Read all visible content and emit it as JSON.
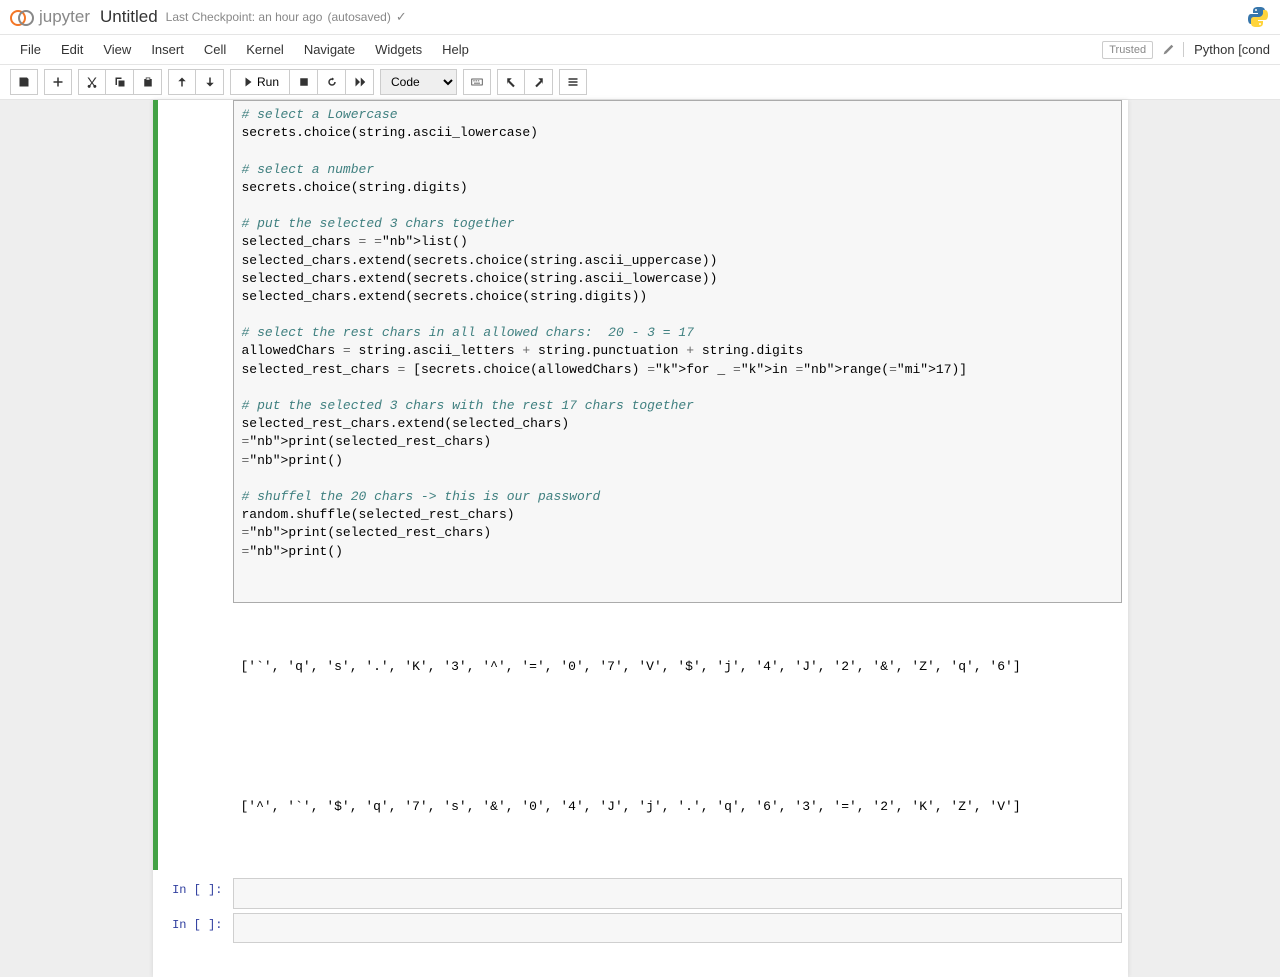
{
  "header": {
    "logo_text": "jupyter",
    "title": "Untitled",
    "checkpoint": "Last Checkpoint: an hour ago",
    "autosave": "(autosaved)"
  },
  "menubar": {
    "items": [
      "File",
      "Edit",
      "View",
      "Insert",
      "Cell",
      "Kernel",
      "Navigate",
      "Widgets",
      "Help"
    ],
    "trusted": "Trusted",
    "kernel": "Python [cond"
  },
  "toolbar": {
    "run_label": "Run",
    "cell_type": "Code"
  },
  "code": {
    "lines": [
      {
        "t": "comment",
        "text": "# select a Lowercase"
      },
      {
        "t": "plain",
        "text": "secrets.choice(string.ascii_lowercase)"
      },
      {
        "t": "blank",
        "text": ""
      },
      {
        "t": "comment",
        "text": "# select a number"
      },
      {
        "t": "plain",
        "text": "secrets.choice(string.digits)"
      },
      {
        "t": "blank",
        "text": ""
      },
      {
        "t": "comment",
        "text": "# put the selected 3 chars together"
      },
      {
        "t": "mixed",
        "text": "selected_chars = list()"
      },
      {
        "t": "plain",
        "text": "selected_chars.extend(secrets.choice(string.ascii_uppercase))"
      },
      {
        "t": "plain",
        "text": "selected_chars.extend(secrets.choice(string.ascii_lowercase))"
      },
      {
        "t": "plain",
        "text": "selected_chars.extend(secrets.choice(string.digits))"
      },
      {
        "t": "blank",
        "text": ""
      },
      {
        "t": "comment",
        "text": "# select the rest chars in all allowed chars:  20 - 3 = 17"
      },
      {
        "t": "mixed2",
        "text": "allowedChars = string.ascii_letters + string.punctuation + string.digits"
      },
      {
        "t": "mixed3",
        "text": "selected_rest_chars = [secrets.choice(allowedChars) for _ in range(17)]"
      },
      {
        "t": "blank",
        "text": ""
      },
      {
        "t": "comment",
        "text": "# put the selected 3 chars with the rest 17 chars together"
      },
      {
        "t": "plain",
        "text": "selected_rest_chars.extend(selected_chars)"
      },
      {
        "t": "print",
        "text": "print(selected_rest_chars)"
      },
      {
        "t": "print2",
        "text": "print()"
      },
      {
        "t": "blank",
        "text": ""
      },
      {
        "t": "comment",
        "text": "# shuffel the 20 chars -> this is our password"
      },
      {
        "t": "plain",
        "text": "random.shuffle(selected_rest_chars)"
      },
      {
        "t": "print",
        "text": "print(selected_rest_chars)"
      },
      {
        "t": "print",
        "text": "print()"
      },
      {
        "t": "blank",
        "text": ""
      },
      {
        "t": "blank",
        "text": ""
      }
    ]
  },
  "output": {
    "line1": "['`', 'q', 's', '.', 'K', '3', '^', '=', '0', '7', 'V', '$', 'j', '4', 'J', '2', '&', 'Z', 'q', '6']",
    "line2": "['^', '`', '$', 'q', '7', 's', '&', '0', '4', 'J', 'j', '.', 'q', '6', '3', '=', '2', 'K', 'Z', 'V']"
  },
  "empty_prompt": "In [ ]:"
}
